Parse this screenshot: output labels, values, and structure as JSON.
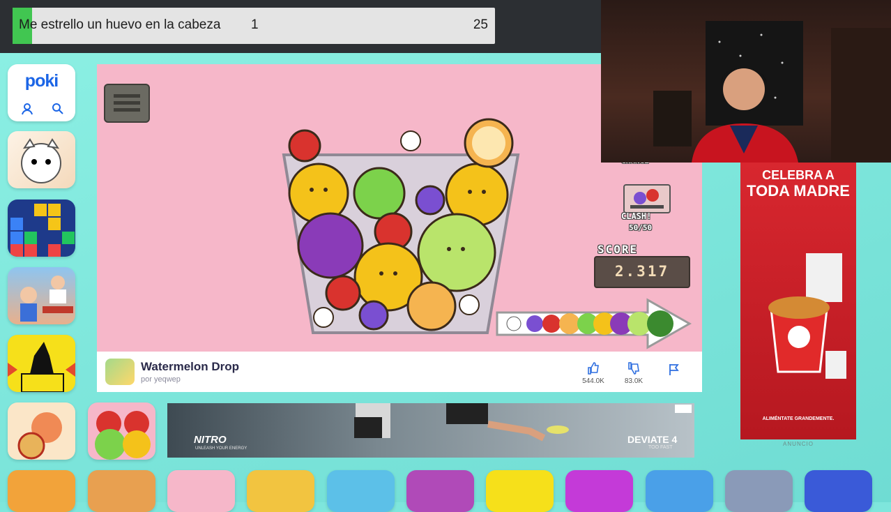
{
  "stream_goal": {
    "label": "Me estrello un huevo en la cabeza",
    "current": "1",
    "target": "25",
    "progress_fraction": 0.04,
    "fill_color": "#41c651"
  },
  "poki": {
    "logo_text": "poki",
    "user_icon": "user-icon",
    "search_icon": "search-icon"
  },
  "game": {
    "title": "Watermelon Drop",
    "author": "por yeqwep",
    "score_label": "SCORE",
    "score_value": "2.317",
    "clash_label": "CLASH!",
    "clash_count": "50/50",
    "change_label": "CHANGE",
    "likes": "544.0K",
    "dislikes": "83.0K",
    "menu_icon": "hamburger-menu-icon",
    "like_icon": "thumbs-up-icon",
    "dislike_icon": "thumbs-down-icon",
    "report_icon": "flag-icon",
    "background_color": "#f6b7c9"
  },
  "ads": {
    "right_line1": "CELEBRA A",
    "right_line2": "TODA MADRE",
    "right_footer": "ALIMÉNTATE GRANDEMENTE.",
    "anuncio": "ANUNCIO",
    "bottom_brand": "NITRO",
    "bottom_brand_sub": "UNLEASH YOUR ENERGY",
    "bottom_product": "DEVIATE 4",
    "bottom_product_sub": "TOO FAST"
  },
  "thumbnails_left": [
    "cat-game-thumb",
    "block-puzzle-thumb",
    "restaurant-game-thumb",
    "stickman-game-thumb"
  ],
  "thumbnails_bottom": [
    "pizza-cat-thumb",
    "fruit-merge-thumb",
    "fruit-slice-thumb",
    "drop-game-thumb",
    "grape-game-thumb",
    "subway-surfers-thumb",
    "fish-game-thumb",
    "word-game-thumb",
    "blocky-game-thumb",
    "snake-game-thumb",
    "knife-game-thumb",
    "sort-game-thumb",
    "bubble-shooter-thumb"
  ]
}
